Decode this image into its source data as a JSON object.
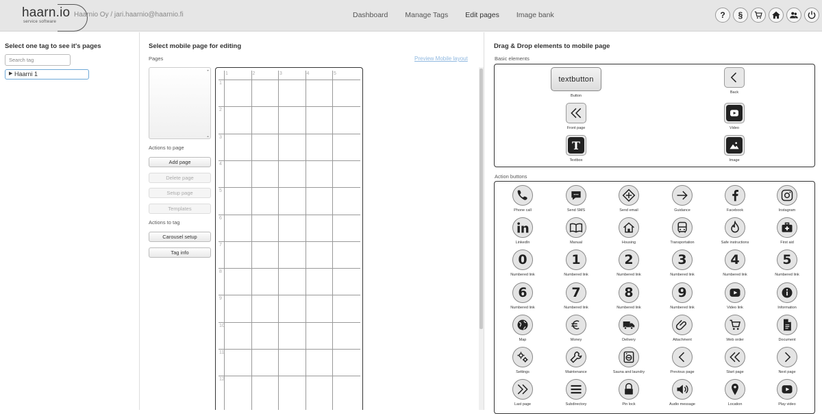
{
  "header": {
    "logo_text": "haarn.io",
    "logo_sub": "service software",
    "company": "Haarnio Oy / jari.haarnio@haarnio.fi",
    "nav": [
      "Dashboard",
      "Manage Tags",
      "Edit pages",
      "Image bank"
    ],
    "active_nav": "Edit pages",
    "icons": [
      "help-icon",
      "legal-icon",
      "cart-icon",
      "home-icon",
      "users-icon",
      "power-icon"
    ]
  },
  "left": {
    "title": "Select one tag to see it's pages",
    "search_placeholder": "Search tag",
    "tag": "Haarni 1"
  },
  "middle": {
    "title": "Select mobile page for editing",
    "pages_label": "Pages",
    "actions_page_label": "Actions to page",
    "buttons": [
      "Add page",
      "Delete page",
      "Setup page",
      "Templates"
    ],
    "actions_tag_label": "Actions to tag",
    "tag_buttons": [
      "Carousel setup",
      "Tag info"
    ],
    "preview_link": "Preview Mobile layout",
    "grid_cols": [
      "1",
      "2",
      "3",
      "4",
      "5"
    ],
    "grid_rows": [
      "1",
      "2",
      "3",
      "4",
      "5",
      "6",
      "7",
      "8",
      "9",
      "10",
      "11",
      "12"
    ]
  },
  "right": {
    "title": "Drag & Drop elements to mobile page",
    "basic_label": "Basic elements",
    "basic": [
      {
        "label": "Button",
        "text": "textbutton"
      },
      {
        "label": "Back"
      },
      {
        "label": "Front page"
      },
      {
        "label": "Video"
      },
      {
        "label": "Textbox",
        "glyph": "T"
      },
      {
        "label": "Image"
      }
    ],
    "action_label": "Action buttons",
    "actions": [
      {
        "label": "Phone call",
        "icon": "phone-icon"
      },
      {
        "label": "Send SMS",
        "icon": "sms-icon"
      },
      {
        "label": "Send email",
        "icon": "email-icon"
      },
      {
        "label": "Guidance",
        "icon": "arrow-right-icon"
      },
      {
        "label": "Facebook",
        "icon": "facebook-icon"
      },
      {
        "label": "Instagram",
        "icon": "instagram-icon"
      },
      {
        "label": "LinkedIn",
        "icon": "linkedin-icon"
      },
      {
        "label": "Manual",
        "icon": "book-icon"
      },
      {
        "label": "Housing",
        "icon": "house-icon"
      },
      {
        "label": "Transportation",
        "icon": "bus-icon"
      },
      {
        "label": "Safe instructions",
        "icon": "fire-icon"
      },
      {
        "label": "First aid",
        "icon": "first-aid-icon"
      },
      {
        "label": "Numbered link",
        "num": "0"
      },
      {
        "label": "Numbered link",
        "num": "1"
      },
      {
        "label": "Numbered link",
        "num": "2"
      },
      {
        "label": "Numbered link",
        "num": "3"
      },
      {
        "label": "Numbered link",
        "num": "4"
      },
      {
        "label": "Numbered link",
        "num": "5"
      },
      {
        "label": "Numbered link",
        "num": "6"
      },
      {
        "label": "Numbered link",
        "num": "7"
      },
      {
        "label": "Numbered link",
        "num": "8"
      },
      {
        "label": "Numbered link",
        "num": "9"
      },
      {
        "label": "Video link",
        "icon": "video-icon"
      },
      {
        "label": "Information",
        "icon": "info-icon"
      },
      {
        "label": "Map",
        "icon": "globe-icon"
      },
      {
        "label": "Money",
        "icon": "euro-icon"
      },
      {
        "label": "Delivery",
        "icon": "truck-icon"
      },
      {
        "label": "Attachment",
        "icon": "paperclip-icon"
      },
      {
        "label": "Web order",
        "icon": "cart-icon"
      },
      {
        "label": "Document",
        "icon": "document-icon"
      },
      {
        "label": "Settings",
        "icon": "gears-icon"
      },
      {
        "label": "Maintenance",
        "icon": "wrench-icon"
      },
      {
        "label": "Sauna and laundry",
        "icon": "washer-icon"
      },
      {
        "label": "Previous page",
        "icon": "chevron-left-icon"
      },
      {
        "label": "Start page",
        "icon": "double-chevron-left-icon"
      },
      {
        "label": "Next page",
        "icon": "chevron-right-icon"
      },
      {
        "label": "Last page",
        "icon": "double-chevron-right-icon"
      },
      {
        "label": "Subdirectory",
        "icon": "menu-icon"
      },
      {
        "label": "Pin lock",
        "icon": "lock-icon"
      },
      {
        "label": "Audio message",
        "icon": "speaker-icon"
      },
      {
        "label": "Location",
        "icon": "pin-icon"
      },
      {
        "label": "Play video",
        "icon": "play-icon"
      }
    ]
  }
}
